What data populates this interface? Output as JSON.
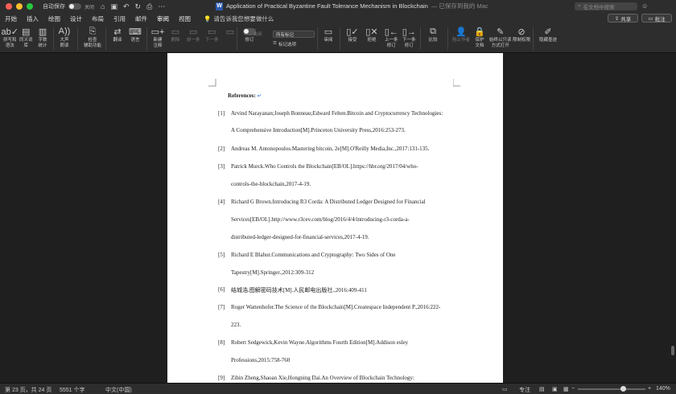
{
  "titlebar": {
    "autosave_label": "自动保存",
    "autosave_state": "关闭",
    "doc_title": "Application of Practical Byzantine Fault Tolerance Mechanism in Blockchain",
    "saved_status": "— 已保存到我的 Mac",
    "search_placeholder": "在文档中搜索"
  },
  "tabs": [
    {
      "label": "开始"
    },
    {
      "label": "插入"
    },
    {
      "label": "绘图"
    },
    {
      "label": "设计"
    },
    {
      "label": "布局"
    },
    {
      "label": "引用"
    },
    {
      "label": "邮件"
    },
    {
      "label": "审阅"
    },
    {
      "label": "视图"
    }
  ],
  "active_tab": "审阅",
  "tellme": "请告诉我您想要做什么",
  "share_label": "共享",
  "comments_label": "批注",
  "ribbon": {
    "spelling": "拼写和\n语法",
    "thesaurus": "同义词\n库",
    "wordcount": "字数\n统计",
    "readaloud": "大声\n朗读",
    "accessibility": "检查\n辅助功能",
    "translate": "翻译",
    "language": "语言",
    "new_comment": "新建\n注释",
    "delete": "删除",
    "previous": "前一条",
    "next": "下一条",
    "show_comments": "",
    "track": "修订",
    "track_state": "关闭",
    "markup_select": "所有标记",
    "markup_options": "标记选项",
    "review_pane": "审阅",
    "accept": "接受",
    "reject": "拒绝",
    "prev_change": "上一条\n修订",
    "next_change": "下一条\n修订",
    "compare": "比较",
    "block_authors": "阻止作者",
    "protect": "保护\n文档",
    "always_readonly": "始终以只读\n方式打开",
    "restrict": "限制权限",
    "hide_ink": "隐藏墨迹"
  },
  "document": {
    "references_title": "References:",
    "references": [
      {
        "num": "[1]",
        "lines": [
          "Arvind Narayanan;Joseph Bonneau;Edward Felten.Bitcoin and Cryptocurrency Technologies:",
          "A Comprehensive Introduction[M].Princeton University Press,2016:253-273."
        ]
      },
      {
        "num": "[2]",
        "lines": [
          "Andreas M. Antonopoulos.Mastering bitcoin, 2e[M].O'Reilly Media,Inc.,2017:131-135."
        ]
      },
      {
        "num": "[3]",
        "lines": [
          "Patrick Murck.Who Controls the Blockchain[EB/OL].https://hbr.org/2017/04/who-",
          "controls-the-blockchain,2017-4-19."
        ]
      },
      {
        "num": "[4]",
        "lines": [
          "Richard G Brown.Introducing R3 Corda: A Distributed Ledger Designed for Financial",
          "Services[EB/OL].http://www.r3cev.com/blog/2016/4/4/introducing-r3-corda-a-",
          "distributed-ledger-designed-for-financial-services,2017-4-19."
        ]
      },
      {
        "num": "[5]",
        "lines": [
          "Richard E Blahut.Communications and Cryptography: Two Sides of One",
          "Tapestry[M].Springer.,2012:309-312"
        ]
      },
      {
        "num": "[6]",
        "lines": [
          "结城浩.图解密码技术[M].人民邮电出版社.,2016:409-411"
        ]
      },
      {
        "num": "[7]",
        "lines": [
          "Roger Wattenhofer.The Science of the Blockchain[M].Createspace Independent P.,2016:222-",
          "223."
        ]
      },
      {
        "num": "[8]",
        "lines": [
          "Robert Sedgewick,Kevin Wayne.Algorithms Fourth Edition[M].Addison esley",
          "Professions,2015:758-760"
        ]
      },
      {
        "num": "[9]",
        "lines": [
          "Zibin Zheng,Shaoan Xie,Hongning Dai.An Overview of Blockchain Technology:"
        ]
      }
    ]
  },
  "statusbar": {
    "page": "第 23 页，共 24 页",
    "words": "5551 个字",
    "language": "中文(中国)",
    "focus": "专注",
    "zoom": "140%"
  },
  "colors": {
    "accent": "#5b8def",
    "chrome": "#2d2d2d",
    "canvas": "#1f1f1f"
  }
}
